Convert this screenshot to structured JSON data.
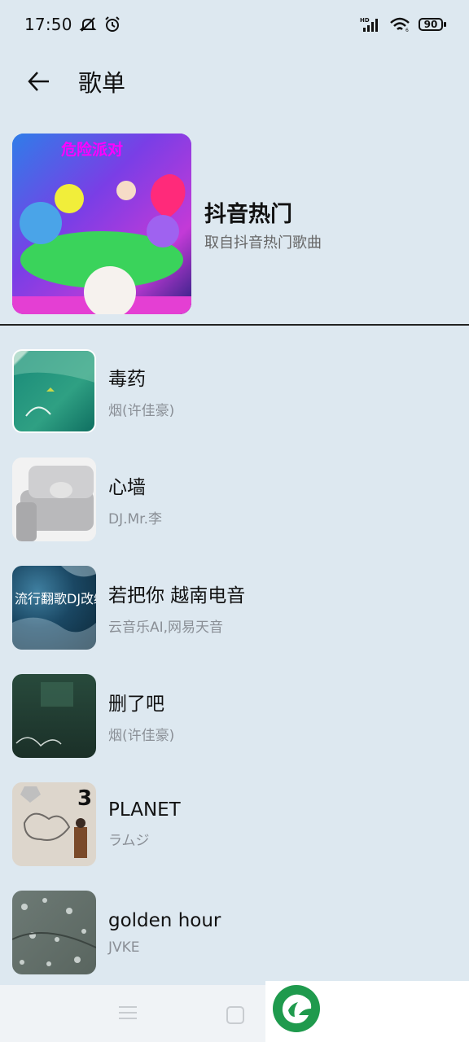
{
  "status_bar": {
    "time": "17:50",
    "battery": "90",
    "icons": [
      "mute-icon",
      "alarm-icon",
      "hd-signal-icon",
      "wifi-icon",
      "battery-icon"
    ]
  },
  "header": {
    "title": "歌单",
    "back_icon": "arrow-left-icon"
  },
  "playlist": {
    "title": "抖音热门",
    "subtitle": "取自抖音热门歌曲",
    "cover_text": "危险派对"
  },
  "songs": [
    {
      "title": "毒药",
      "artist": "烟(许佳豪)",
      "cover_color": "#1f8a78"
    },
    {
      "title": "心墙",
      "artist": "DJ.Mr.李",
      "cover_color": "#cfcfd2"
    },
    {
      "title": "若把你 越南电音",
      "artist": "云音乐AI,网易天音",
      "cover_color": "#1d4e6b",
      "cover_text": "流行翻歌DJ改编"
    },
    {
      "title": "删了吧",
      "artist": "烟(许佳豪)",
      "cover_color": "#1f3a2f"
    },
    {
      "title": "PLANET",
      "artist": "ラムジ",
      "cover_color": "#d9d2c6",
      "cover_text": "3"
    },
    {
      "title": "golden hour",
      "artist": "JVKE",
      "cover_color": "#5f6b67"
    }
  ],
  "nav": {
    "menu_icon": "menu-icon",
    "home_icon": "home-icon",
    "logo_icon": "app-logo-icon"
  }
}
